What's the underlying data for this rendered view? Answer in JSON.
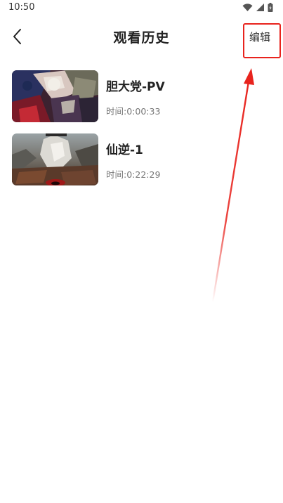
{
  "status_bar": {
    "time": "10:50",
    "icons": [
      "wifi-icon",
      "signal-icon",
      "battery-icon"
    ]
  },
  "header": {
    "title": "观看历史",
    "edit_label": "编辑",
    "back_icon": "chevron-left-icon"
  },
  "history": [
    {
      "title": "胆大党-PV",
      "time": "时间:0:00:33"
    },
    {
      "title": "仙逆-1",
      "time": "时间:0:22:29"
    }
  ],
  "colors": {
    "annotation": "#e8231d",
    "title_text": "#222222",
    "secondary_text": "#777777"
  }
}
